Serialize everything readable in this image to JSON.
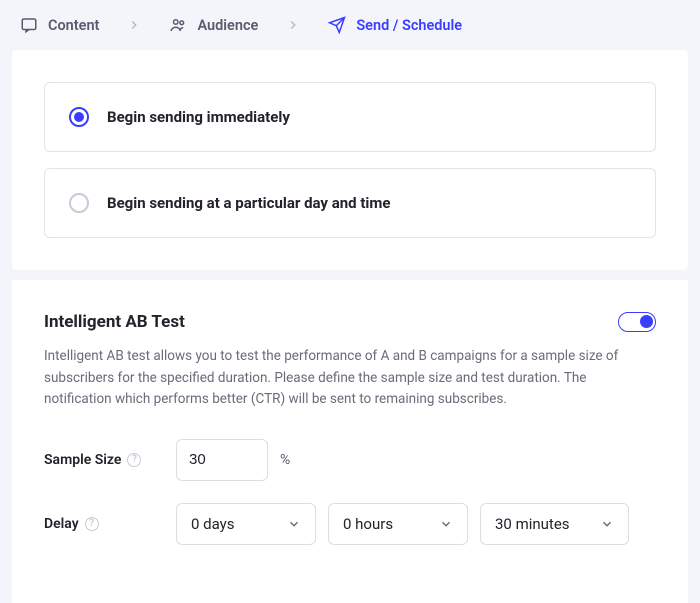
{
  "breadcrumb": {
    "content": "Content",
    "audience": "Audience",
    "send": "Send / Schedule"
  },
  "schedule": {
    "option1": "Begin sending immediately",
    "option2": "Begin sending at a particular day and time"
  },
  "abtest": {
    "title": "Intelligent AB Test",
    "description": "Intelligent AB test allows you to test the performance of A and B campaigns for a sample size of subscribers for the specified duration. Please define the sample size and test duration. The notification which performs better (CTR) will be sent to remaining subscribes.",
    "sample_label": "Sample Size",
    "sample_value": "30",
    "sample_unit": "%",
    "delay_label": "Delay",
    "delay_days": "0 days",
    "delay_hours": "0 hours",
    "delay_minutes": "30 minutes"
  }
}
